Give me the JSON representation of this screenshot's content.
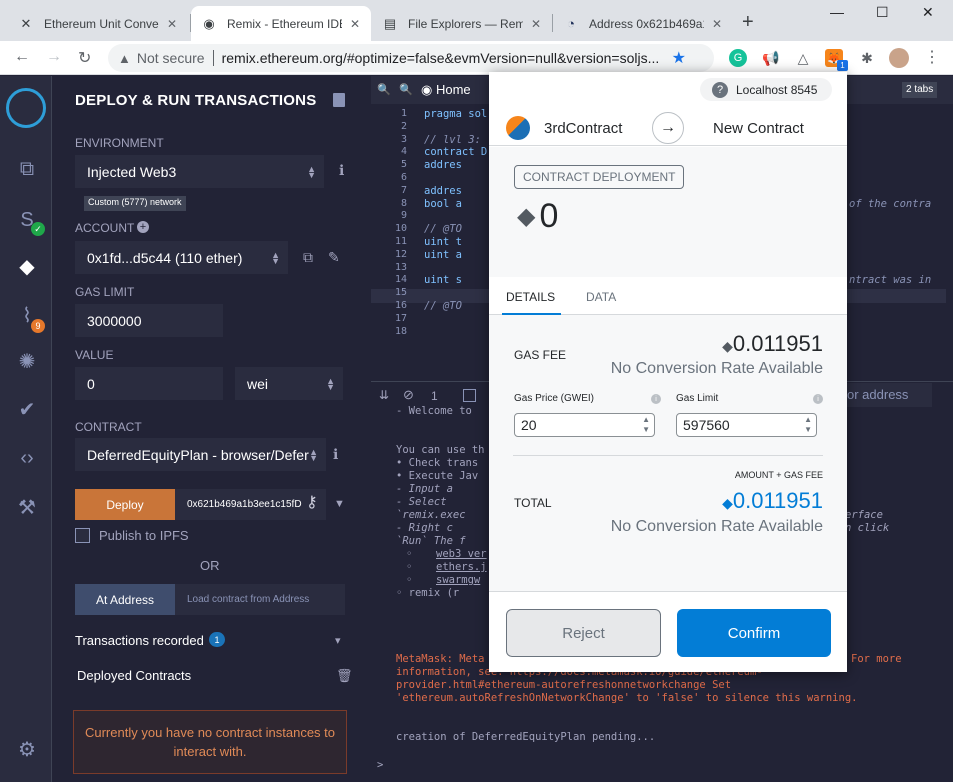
{
  "browser": {
    "tabs": [
      {
        "title": "Ethereum Unit Conve",
        "icon": "ethereum-icon"
      },
      {
        "title": "Remix - Ethereum IDE",
        "icon": "remix-icon",
        "active": true
      },
      {
        "title": "File Explorers — Remi",
        "icon": "book-icon"
      },
      {
        "title": "Address 0x621b469a1",
        "icon": "etherscan-icon"
      }
    ],
    "security_label": "Not secure",
    "url": "remix.ethereum.org/#optimize=false&evmVersion=null&version=soljs...",
    "metamask_badge": "1"
  },
  "iconbar": {
    "badge_analysis": "9"
  },
  "deploy_panel": {
    "title": "DEPLOY & RUN TRANSACTIONS",
    "environment_label": "ENVIRONMENT",
    "environment_value": "Injected Web3",
    "network_badge": "Custom (5777) network",
    "account_label": "ACCOUNT",
    "account_value": "0x1fd...d5c44 (110 ether)",
    "gas_limit_label": "GAS LIMIT",
    "gas_limit_value": "3000000",
    "value_label": "VALUE",
    "value_amount": "0",
    "value_unit": "wei",
    "contract_label": "CONTRACT",
    "contract_value": "DeferredEquityPlan - browser/Defer",
    "deploy_button": "Deploy",
    "deploy_args": "0x621b469a1b3ee1c15fD",
    "publish_ipfs": "Publish to IPFS",
    "or": "OR",
    "at_address_button": "At Address",
    "at_address_placeholder": "Load contract from Address",
    "transactions_recorded": "Transactions recorded",
    "transactions_count": "1",
    "deployed_contracts": "Deployed Contracts",
    "no_instances": "Currently you have no contract instances to interact with."
  },
  "editor": {
    "home_tab": "Home",
    "tabs_count": "2 tabs",
    "line_numbers": [
      "1",
      "2",
      "3",
      "4",
      "5",
      "6",
      "7",
      "8",
      "9",
      "10",
      "11",
      "12",
      "13",
      "14",
      "15",
      "16",
      "17",
      "18"
    ],
    "code_lines": [
      {
        "text": "pragma sol",
        "cls": "kw"
      },
      {
        "text": "",
        "cls": ""
      },
      {
        "text": "// lvl 3:",
        "cls": "cm"
      },
      {
        "text": "contract D",
        "cls": "kw"
      },
      {
        "text": "    addres",
        "cls": "kw"
      },
      {
        "text": "",
        "cls": ""
      },
      {
        "text": "    addres",
        "cls": "kw"
      },
      {
        "text": "    bool a",
        "cls": "kw"
      },
      {
        "text": "",
        "cls": ""
      },
      {
        "text": "    // @TO",
        "cls": "cm"
      },
      {
        "text": "    uint t",
        "cls": "kw"
      },
      {
        "text": "    uint a",
        "cls": "kw"
      },
      {
        "text": "",
        "cls": ""
      },
      {
        "text": "    uint s",
        "cls": "kw"
      },
      {
        "text": "",
        "cls": ""
      },
      {
        "text": "    // @TO",
        "cls": "cm"
      },
      {
        "text": "",
        "cls": ""
      },
      {
        "text": "",
        "cls": ""
      }
    ],
    "code_right": [
      {
        "text": "of the contra",
        "row": 8
      },
      {
        "text": "ntract was in",
        "row": 14
      }
    ],
    "terminal_count": "1",
    "terminal_search": "or address",
    "terminal": {
      "welcome": " - Welcome to",
      "use": "You can use th",
      "check": " • Check trans",
      "exec": " • Execute Jav",
      "input": "    - Input a",
      "select": "    - Select",
      "remix_exec": "  `remix.exec",
      "right": "    - Right c",
      "run": "  `Run` The f",
      "web3": "web3 ver",
      "ethers": "ethers.j",
      "swarm": "swarmgw",
      "remix_r": "  ◦ remix (r",
      "erface": "erface",
      "nclick": "n click",
      "warn1": "MetaMask: Meta",
      "warn1b": "For more",
      "warn2": "information, see: https://docs.metamask.io/guide/ethereum-",
      "warn3": "provider.html#ethereum-autorefreshonnetworkchange Set",
      "warn4": "'ethereum.autoRefreshOnNetworkChange' to 'false' to silence this warning.",
      "pending": "creation of DeferredEquityPlan pending...",
      "prompt": ">"
    }
  },
  "metamask": {
    "network": "Localhost 8545",
    "from_account": "3rdContract",
    "to": "New Contract",
    "action_tag": "CONTRACT DEPLOYMENT",
    "amount": "0",
    "tab_details": "DETAILS",
    "tab_data": "DATA",
    "gas_fee_label": "GAS FEE",
    "gas_fee_value": "0.011951",
    "no_conversion": "No Conversion Rate Available",
    "gas_price_label": "Gas Price (GWEI)",
    "gas_price_value": "20",
    "gas_limit_label": "Gas Limit",
    "gas_limit_value": "597560",
    "amount_gas_fee_label": "AMOUNT + GAS FEE",
    "total_label": "TOTAL",
    "total_value": "0.011951",
    "total_no_conversion": "No Conversion Rate Available",
    "reject": "Reject",
    "confirm": "Confirm",
    "accent": "#037dd6"
  }
}
